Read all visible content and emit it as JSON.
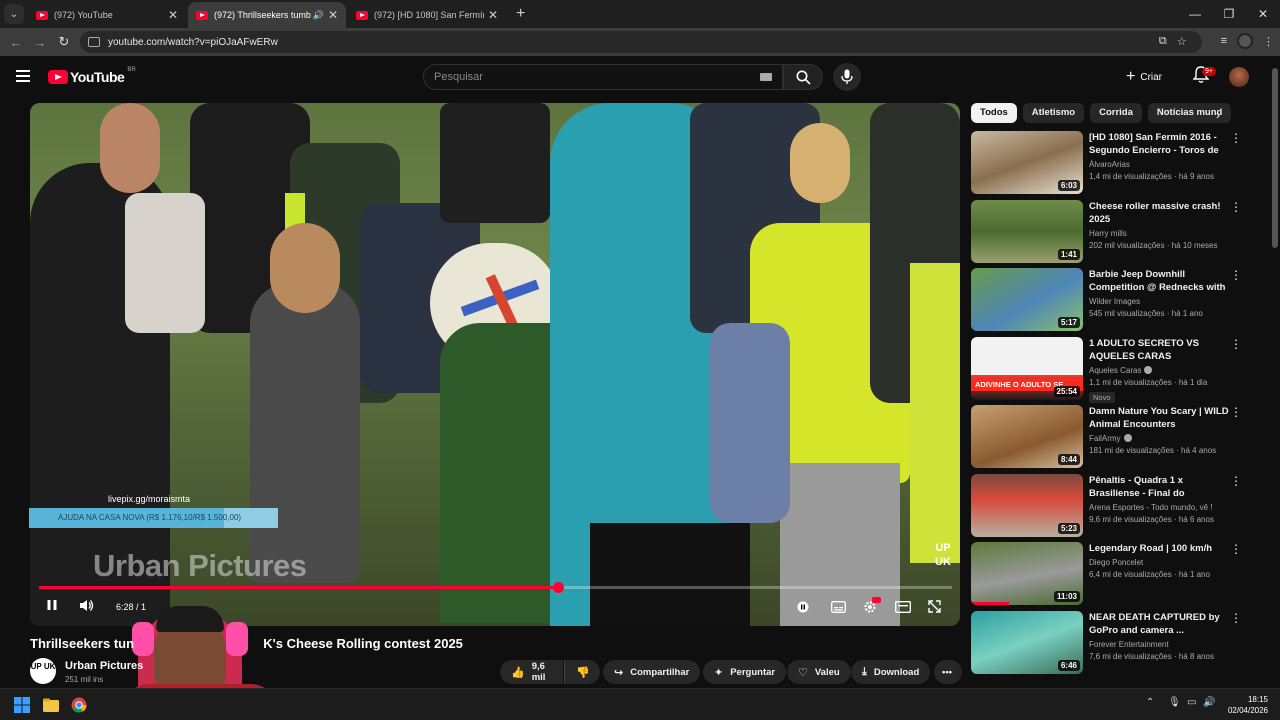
{
  "browser": {
    "tabs": [
      {
        "title": "(972) YouTube",
        "active": false
      },
      {
        "title": "(972) Thrillseekers tumble d",
        "active": true
      },
      {
        "title": "(972) [HD 1080] San Fermín 20",
        "active": false
      }
    ],
    "url": "youtube.com/watch?v=piOJaAFwERw",
    "new_tab_glyph": "+",
    "close_glyph": "✕"
  },
  "header": {
    "logo_text": "YouTube",
    "region": "BR",
    "search_placeholder": "Pesquisar",
    "create_label": "Criar",
    "notifications_badge": "9+"
  },
  "player": {
    "watermark": "Urban Pictures",
    "corner_logo": "UP UK",
    "donation_url": "livepix.gg/moraismta",
    "donation_text": "AJUDA NA CASA NOVA (R$ 1.176,10/R$ 1.500,00)",
    "donation_progress": 0.784,
    "time_display": "6:28 / 1",
    "progress_fraction": 0.568
  },
  "video": {
    "title_visible_left": "Thrillseekers tun",
    "title_visible_right": "K's Cheese Rolling contest 2025",
    "channel_name": "Urban Pictures",
    "channel_avatar": "UP UK",
    "subscribers": "251 mil ins",
    "actions": {
      "like": "9,6 mil",
      "share": "Compartilhar",
      "ask": "Perguntar",
      "thanks": "Valeu",
      "download": "Download"
    }
  },
  "sidebar": {
    "chips": [
      "Todos",
      "Atletismo",
      "Corrida",
      "Notícias mund"
    ],
    "recommendations": [
      {
        "title": "[HD 1080] San Fermín 2016 - Segundo Encierro - Toros de la...",
        "channel": "ÁlvaroArias",
        "meta": "1,4 mi de visualizações · há 9 anos",
        "duration": "6:03",
        "verified": false,
        "badge": ""
      },
      {
        "title": "Cheese roller massive crash! 2025",
        "channel": "Harry mills",
        "meta": "202 mil visualizações · há 10 meses",
        "duration": "1:41",
        "verified": false,
        "badge": ""
      },
      {
        "title": "Barbie Jeep Downhill Competition @ Rednecks with ...",
        "channel": "Wilder Images",
        "meta": "545 mil visualizações · há 1 ano",
        "duration": "5:17",
        "verified": false,
        "badge": ""
      },
      {
        "title": "1 ADULTO SECRETO VS AQUELES CARAS",
        "channel": "Aqueles Caras",
        "meta": "1,1 mi de visualizações · há 1 dia",
        "duration": "25:54",
        "verified": true,
        "badge": "Novo",
        "thumb_text": "ADIVINHE O ADULTO SE"
      },
      {
        "title": "Damn Nature You Scary | WILD Animal Encounters",
        "channel": "FailArmy",
        "meta": "181 mi de visualizações · há 4 anos",
        "duration": "8:44",
        "verified": true,
        "badge": ""
      },
      {
        "title": "Pênaltis - Quadra 1 x Brasiliense - Final do Campeonato Aberto ...",
        "channel": "Arena Esportes - Todo mundo, vê !",
        "meta": "9,6 mi de visualizações · há 6 anos",
        "duration": "5:23",
        "verified": false,
        "badge": ""
      },
      {
        "title": "Legendary Road | 100 km/h",
        "channel": "Diego Poncelet",
        "meta": "6,4 mi de visualizações · há 1 ano",
        "duration": "11:03",
        "verified": false,
        "badge": ""
      },
      {
        "title": "NEAR DEATH CAPTURED by GoPro and camera ...",
        "channel": "Forever Entertainment",
        "meta": "7,6 mi de visualizações · há 8 anos",
        "duration": "6:46",
        "verified": false,
        "badge": ""
      }
    ]
  },
  "taskbar": {
    "time": "18:15",
    "date": "02/04/2026"
  },
  "colors": {
    "brand_red": "#ff0033",
    "background": "#0f0f0f",
    "chip_bg": "#272727",
    "donation_bar": "#8ecde3"
  }
}
